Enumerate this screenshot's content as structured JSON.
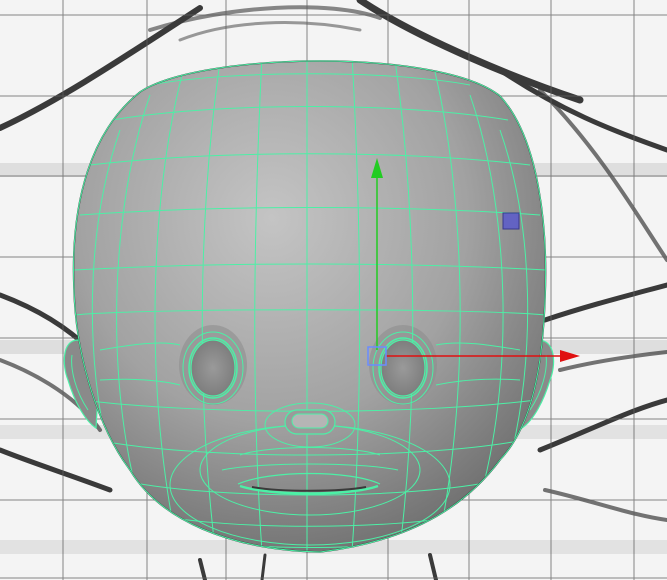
{
  "viewport": {
    "view": "front",
    "background_color": "#f4f4f4",
    "grid_color": "#5f5f5f",
    "sketch_color": "#3a3a3a"
  },
  "model": {
    "shading": "smooth-gray",
    "shading_light": "#c2c2c2",
    "shading_dark": "#6c6c6c",
    "wireframe_color": "#4cf0a6",
    "selected": true
  },
  "manipulator": {
    "type": "move",
    "y_axis_color": "#22cc22",
    "x_axis_color": "#e01010",
    "center_handle_color": "#6a8cff",
    "plane_handle_color": "#4a4ad8"
  }
}
